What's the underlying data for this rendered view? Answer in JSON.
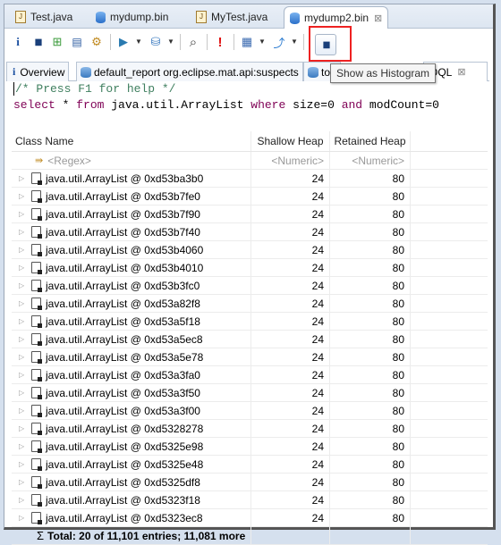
{
  "editor_tabs": [
    {
      "label": "Test.java",
      "icon": "java-file-icon",
      "active": false
    },
    {
      "label": "mydump.bin",
      "icon": "heap-dump-icon",
      "active": false
    },
    {
      "label": "MyTest.java",
      "icon": "java-file-icon",
      "active": false
    },
    {
      "label": "mydump2.bin",
      "icon": "heap-dump-icon",
      "active": true,
      "close": "⊠"
    }
  ],
  "toolbar": {
    "buttons": [
      {
        "name": "overview-icon",
        "glyph": "i"
      },
      {
        "name": "histogram-icon",
        "glyph": "▮▮"
      },
      {
        "name": "dominator-tree-icon",
        "glyph": "⊞"
      },
      {
        "name": "oql-icon",
        "glyph": "▤"
      },
      {
        "name": "top-consumers-icon",
        "glyph": "⚙"
      },
      {
        "name": "run-report-icon",
        "glyph": "▶"
      },
      {
        "name": "query-browser-icon",
        "glyph": "⛁"
      },
      {
        "name": "search-icon",
        "glyph": "⌕"
      },
      {
        "name": "leak-suspects-icon",
        "glyph": "!"
      },
      {
        "name": "calculator-icon",
        "glyph": "▦"
      },
      {
        "name": "export-icon",
        "glyph": "⤴"
      }
    ],
    "highlighted_button": {
      "name": "show-as-histogram-icon",
      "glyph": "▮▮"
    },
    "tooltip": "Show as Histogram"
  },
  "result_tabs": [
    {
      "label": "Overview",
      "icon": "info-icon"
    },
    {
      "label": "default_report  org.eclipse.mat.api:suspects",
      "icon": "report-icon"
    },
    {
      "label": "top",
      "icon": "report-icon"
    },
    {
      "label": "OQL",
      "close": "⊠"
    }
  ],
  "query": {
    "comment": "/* Press F1 for help */",
    "parts": [
      {
        "text": "select",
        "kw": true
      },
      {
        "text": " * ",
        "kw": false
      },
      {
        "text": "from",
        "kw": true
      },
      {
        "text": " java.util.ArrayList ",
        "kw": false
      },
      {
        "text": "where",
        "kw": true
      },
      {
        "text": " size=0 ",
        "kw": false
      },
      {
        "text": "and",
        "kw": true
      },
      {
        "text": " modCount=0",
        "kw": false
      }
    ]
  },
  "table": {
    "columns": [
      "Class Name",
      "Shallow Heap",
      "Retained Heap"
    ],
    "filters": [
      "<Regex>",
      "<Numeric>",
      "<Numeric>"
    ],
    "rows": [
      {
        "name": "java.util.ArrayList @ 0xd53ba3b0",
        "shallow": "24",
        "retained": "80"
      },
      {
        "name": "java.util.ArrayList @ 0xd53b7fe0",
        "shallow": "24",
        "retained": "80"
      },
      {
        "name": "java.util.ArrayList @ 0xd53b7f90",
        "shallow": "24",
        "retained": "80"
      },
      {
        "name": "java.util.ArrayList @ 0xd53b7f40",
        "shallow": "24",
        "retained": "80"
      },
      {
        "name": "java.util.ArrayList @ 0xd53b4060",
        "shallow": "24",
        "retained": "80"
      },
      {
        "name": "java.util.ArrayList @ 0xd53b4010",
        "shallow": "24",
        "retained": "80"
      },
      {
        "name": "java.util.ArrayList @ 0xd53b3fc0",
        "shallow": "24",
        "retained": "80"
      },
      {
        "name": "java.util.ArrayList @ 0xd53a82f8",
        "shallow": "24",
        "retained": "80"
      },
      {
        "name": "java.util.ArrayList @ 0xd53a5f18",
        "shallow": "24",
        "retained": "80"
      },
      {
        "name": "java.util.ArrayList @ 0xd53a5ec8",
        "shallow": "24",
        "retained": "80"
      },
      {
        "name": "java.util.ArrayList @ 0xd53a5e78",
        "shallow": "24",
        "retained": "80"
      },
      {
        "name": "java.util.ArrayList @ 0xd53a3fa0",
        "shallow": "24",
        "retained": "80"
      },
      {
        "name": "java.util.ArrayList @ 0xd53a3f50",
        "shallow": "24",
        "retained": "80"
      },
      {
        "name": "java.util.ArrayList @ 0xd53a3f00",
        "shallow": "24",
        "retained": "80"
      },
      {
        "name": "java.util.ArrayList @ 0xd5328278",
        "shallow": "24",
        "retained": "80"
      },
      {
        "name": "java.util.ArrayList @ 0xd5325e98",
        "shallow": "24",
        "retained": "80"
      },
      {
        "name": "java.util.ArrayList @ 0xd5325e48",
        "shallow": "24",
        "retained": "80"
      },
      {
        "name": "java.util.ArrayList @ 0xd5325df8",
        "shallow": "24",
        "retained": "80"
      },
      {
        "name": "java.util.ArrayList @ 0xd5323f18",
        "shallow": "24",
        "retained": "80"
      },
      {
        "name": "java.util.ArrayList @ 0xd5323ec8",
        "shallow": "24",
        "retained": "80"
      }
    ],
    "total": "Total: 20 of 11,101 entries; 11,081 more",
    "total_icon": "Σ"
  }
}
